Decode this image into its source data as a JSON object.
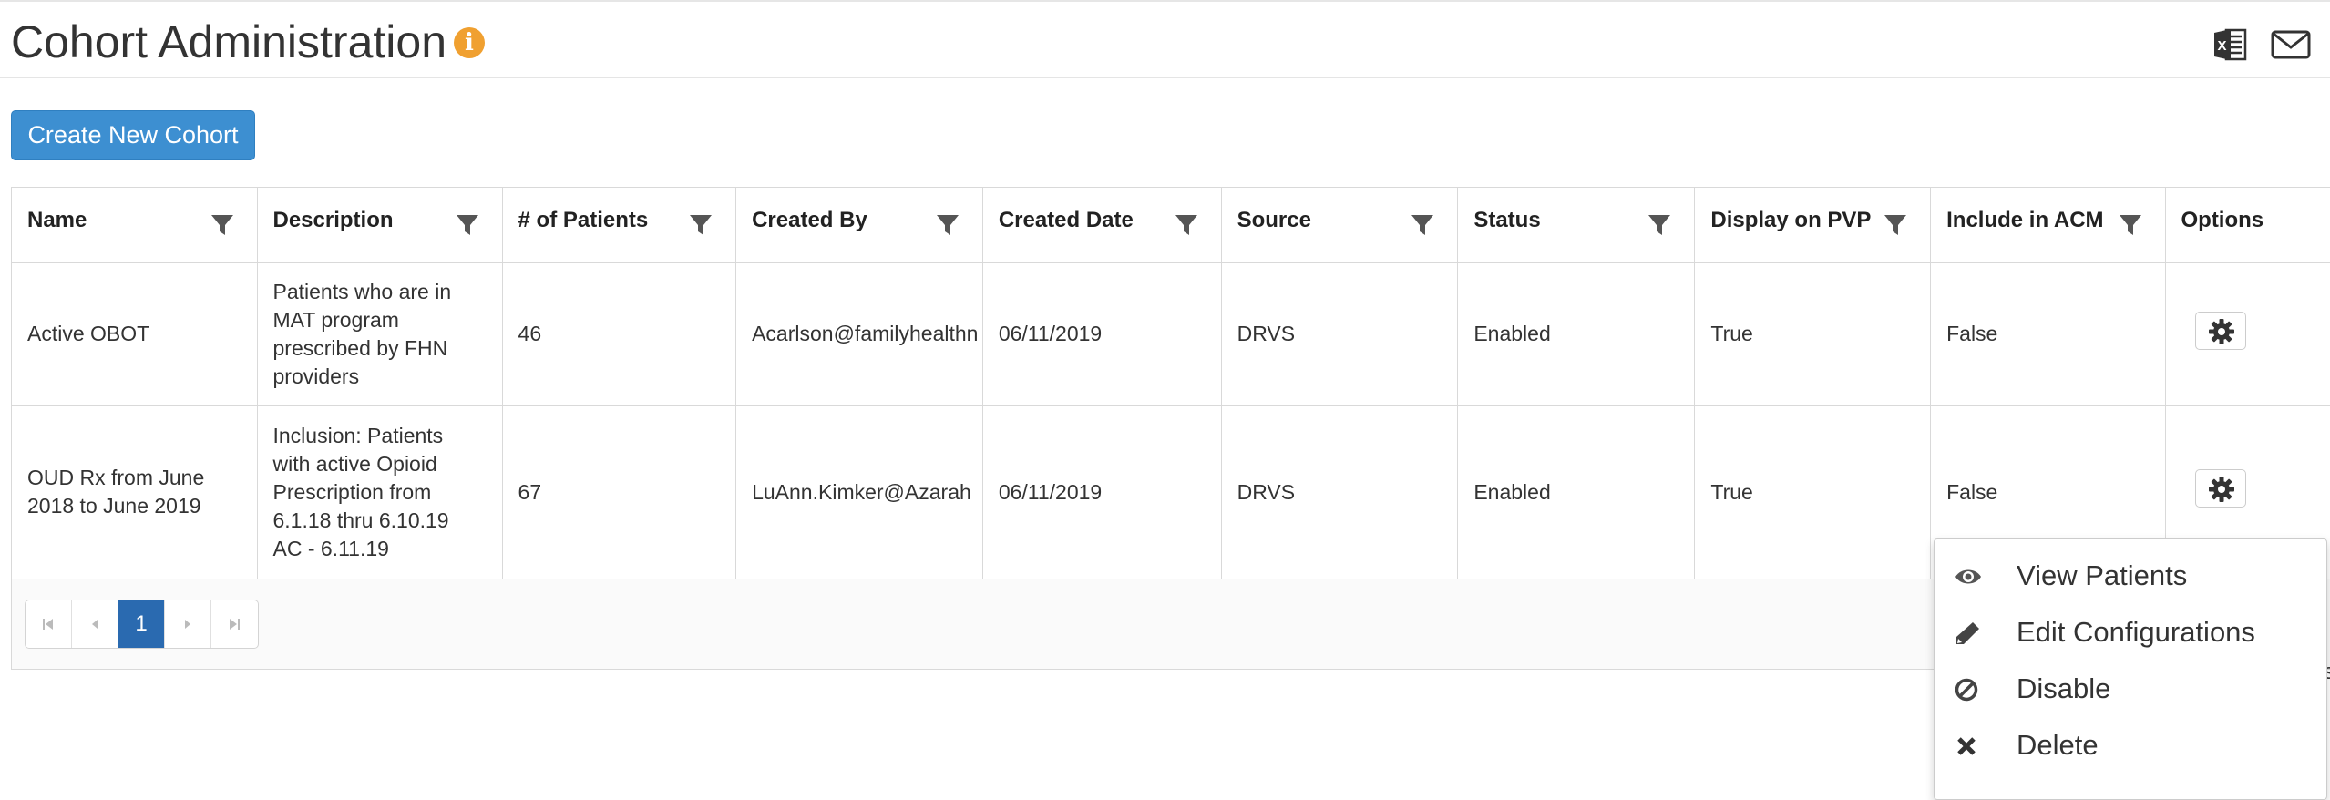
{
  "header": {
    "title": "Cohort Administration"
  },
  "icons": {
    "info": "info-icon",
    "export_excel": "excel-icon",
    "email": "envelope-icon",
    "filter": "filter-icon",
    "options": "gear-icon"
  },
  "colors": {
    "primary_button": "#3d8fd1",
    "info_icon": "#f0a030",
    "active_page": "#2a6ab0"
  },
  "toolbar": {
    "create_label": "Create New Cohort"
  },
  "table": {
    "columns": [
      "Name",
      "Description",
      "# of Patients",
      "Created By",
      "Created Date",
      "Source",
      "Status",
      "Display on PVP",
      "Include in ACM",
      "Options"
    ],
    "rows": [
      {
        "name": "Active OBOT",
        "description": "Patients who are in MAT program prescribed by FHN providers",
        "patients": "46",
        "created_by": "Acarlson@familyhealthn",
        "created_date": "06/11/2019",
        "source": "DRVS",
        "status": "Enabled",
        "display_pvp": "True",
        "include_acm": "False"
      },
      {
        "name": "OUD Rx from June 2018 to June 2019",
        "description": "Inclusion: Patients with active Opioid Prescription from 6.1.18 thru 6.10.19 AC - 6.11.19",
        "patients": "67",
        "created_by": "LuAnn.Kimker@Azarah",
        "created_date": "06/11/2019",
        "source": "DRVS",
        "status": "Enabled",
        "display_pvp": "True",
        "include_acm": "False"
      }
    ]
  },
  "pager": {
    "current_page": "1"
  },
  "context_menu": {
    "items": [
      {
        "label": "View Patients",
        "icon": "eye-icon"
      },
      {
        "label": "Edit Configurations",
        "icon": "pencil-icon"
      },
      {
        "label": "Disable",
        "icon": "ban-icon"
      },
      {
        "label": "Delete",
        "icon": "x-icon"
      }
    ]
  },
  "partial_text": "s"
}
